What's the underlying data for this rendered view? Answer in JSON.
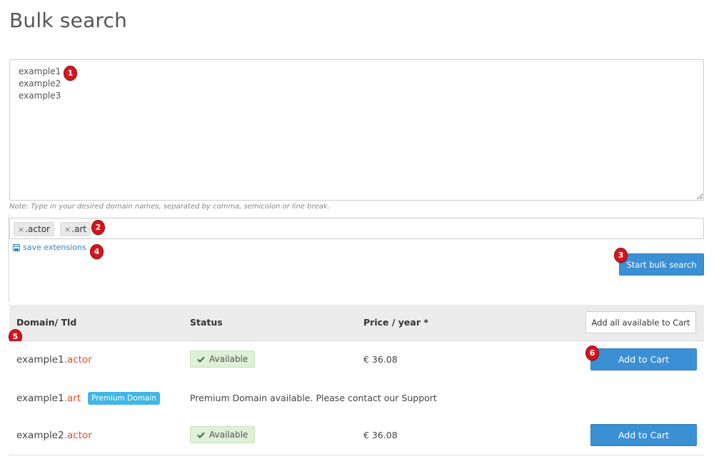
{
  "page": {
    "title": "Bulk search"
  },
  "search": {
    "domains_value": "example1\nexample2\nexample3",
    "note": "Note: Type in your desired domain names, separated by comma, semicolon or line break.",
    "extensions": [
      {
        "label": ".actor"
      },
      {
        "label": ".art"
      }
    ],
    "remove_symbol": "×",
    "save_extensions_label": "save extensions",
    "start_button_label": "Start bulk search"
  },
  "callouts": [
    "1",
    "2",
    "3",
    "4",
    "5",
    "6"
  ],
  "results": {
    "headers": {
      "domain": "Domain/ Tld",
      "status": "Status",
      "price": "Price / year *"
    },
    "add_all_label": "Add all available to Cart",
    "rows": [
      {
        "name": "example1",
        "tld": ".actor",
        "status": "Available",
        "price": "€ 36.08",
        "cart_label": "Add to Cart"
      },
      {
        "name": "example1",
        "tld": ".art",
        "premium_badge": "Premium Domain",
        "status": "Premium Domain available. Please contact our Support"
      },
      {
        "name": "example2",
        "tld": ".actor",
        "status": "Available",
        "price": "€ 36.08",
        "cart_label": "Add to Cart"
      }
    ]
  },
  "colors": {
    "primary_button": "#3b8fd3",
    "tld_text": "#e04f2c",
    "available_bg": "#dff0d8",
    "available_check": "#3c763d",
    "premium_badge": "#40b7e3",
    "callout": "#d8141c",
    "link": "#2a86c9"
  },
  "icons": {
    "save": "floppy-disk-icon",
    "available": "check-icon",
    "resize": "resize-handle-icon"
  }
}
